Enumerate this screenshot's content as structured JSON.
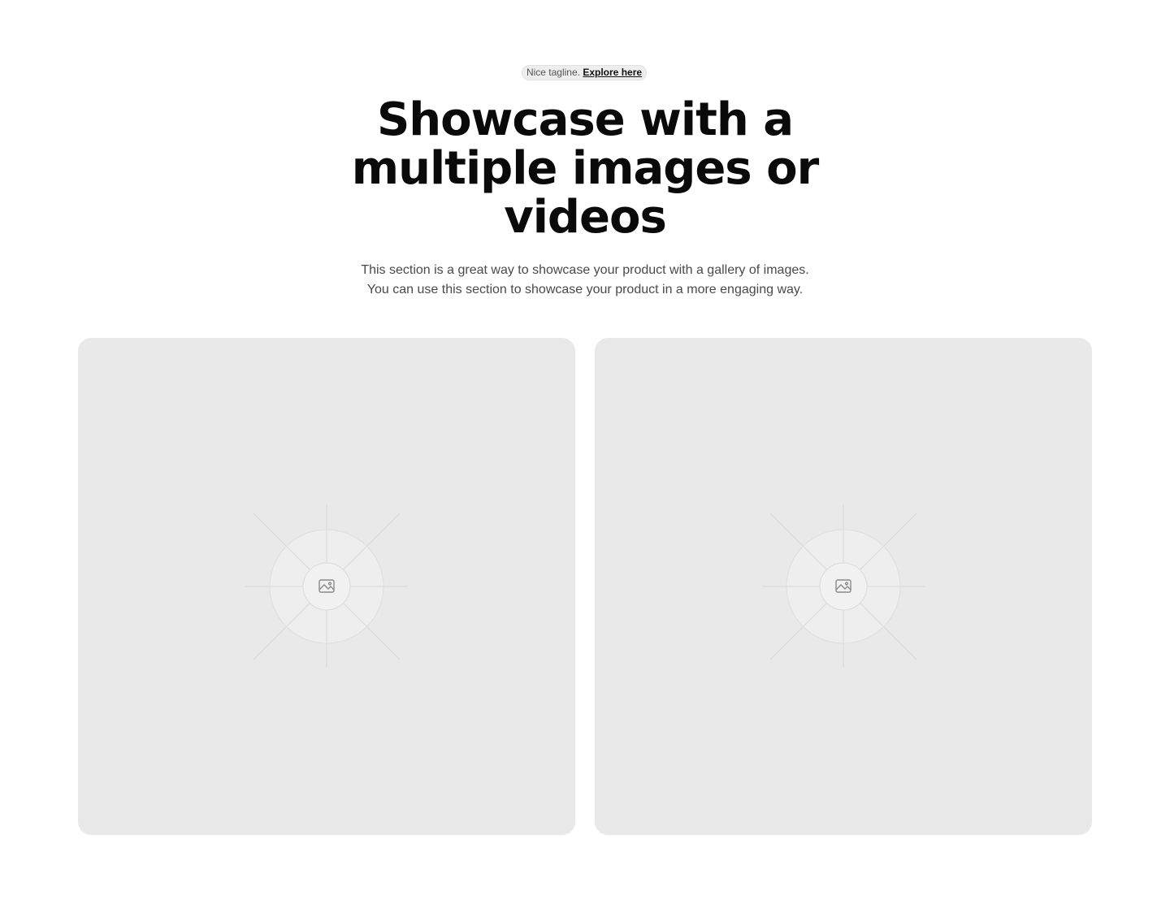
{
  "tagline": {
    "text": "Nice tagline.",
    "link_label": "Explore here"
  },
  "hero": {
    "title_lines": [
      "Showcase with a",
      "multiple images or",
      "videos"
    ],
    "subtitle_lines": [
      "This section is a great way to showcase your product with a gallery of images.",
      "You can use this section to showcase your product in a more engaging way."
    ]
  },
  "gallery": {
    "items": [
      {
        "icon": "image-icon"
      },
      {
        "icon": "image-icon"
      }
    ]
  },
  "colors": {
    "background": "#ffffff",
    "card": "#e9e9e9",
    "title": "#0a0a0a",
    "subtitle": "#4a4a4a"
  }
}
